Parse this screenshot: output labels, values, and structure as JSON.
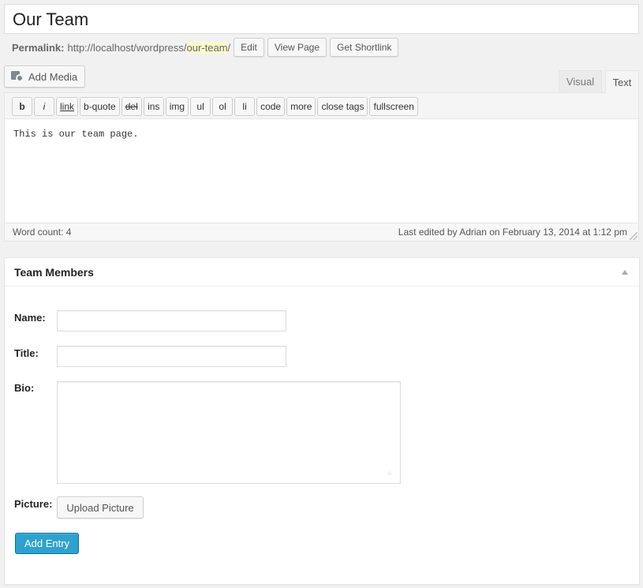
{
  "post": {
    "title": "Our Team",
    "permalink_label": "Permalink:",
    "permalink_base": "http://localhost/wordpress/",
    "permalink_slug": "our-team",
    "permalink_trail": "/",
    "edit_btn": "Edit",
    "view_btn": "View Page",
    "shortlink_btn": "Get Shortlink"
  },
  "editor": {
    "add_media": "Add Media",
    "tabs": {
      "visual": "Visual",
      "text": "Text"
    },
    "quicktags": [
      "b",
      "i",
      "link",
      "b-quote",
      "del",
      "ins",
      "img",
      "ul",
      "ol",
      "li",
      "code",
      "more",
      "close tags",
      "fullscreen"
    ],
    "content": "This is our team page.",
    "word_count": "Word count: 4",
    "last_edited": "Last edited by Adrian on February 13, 2014 at 1:12 pm"
  },
  "metabox": {
    "title": "Team Members",
    "name_label": "Name:",
    "name_value": "",
    "title_label": "Title:",
    "title_value": "",
    "bio_label": "Bio:",
    "bio_value": "",
    "picture_label": "Picture:",
    "upload_btn": "Upload Picture",
    "add_entry_btn": "Add Entry"
  },
  "colors": {
    "primary": "#2ea2cc",
    "slug_highlight": "#fffbcc"
  }
}
